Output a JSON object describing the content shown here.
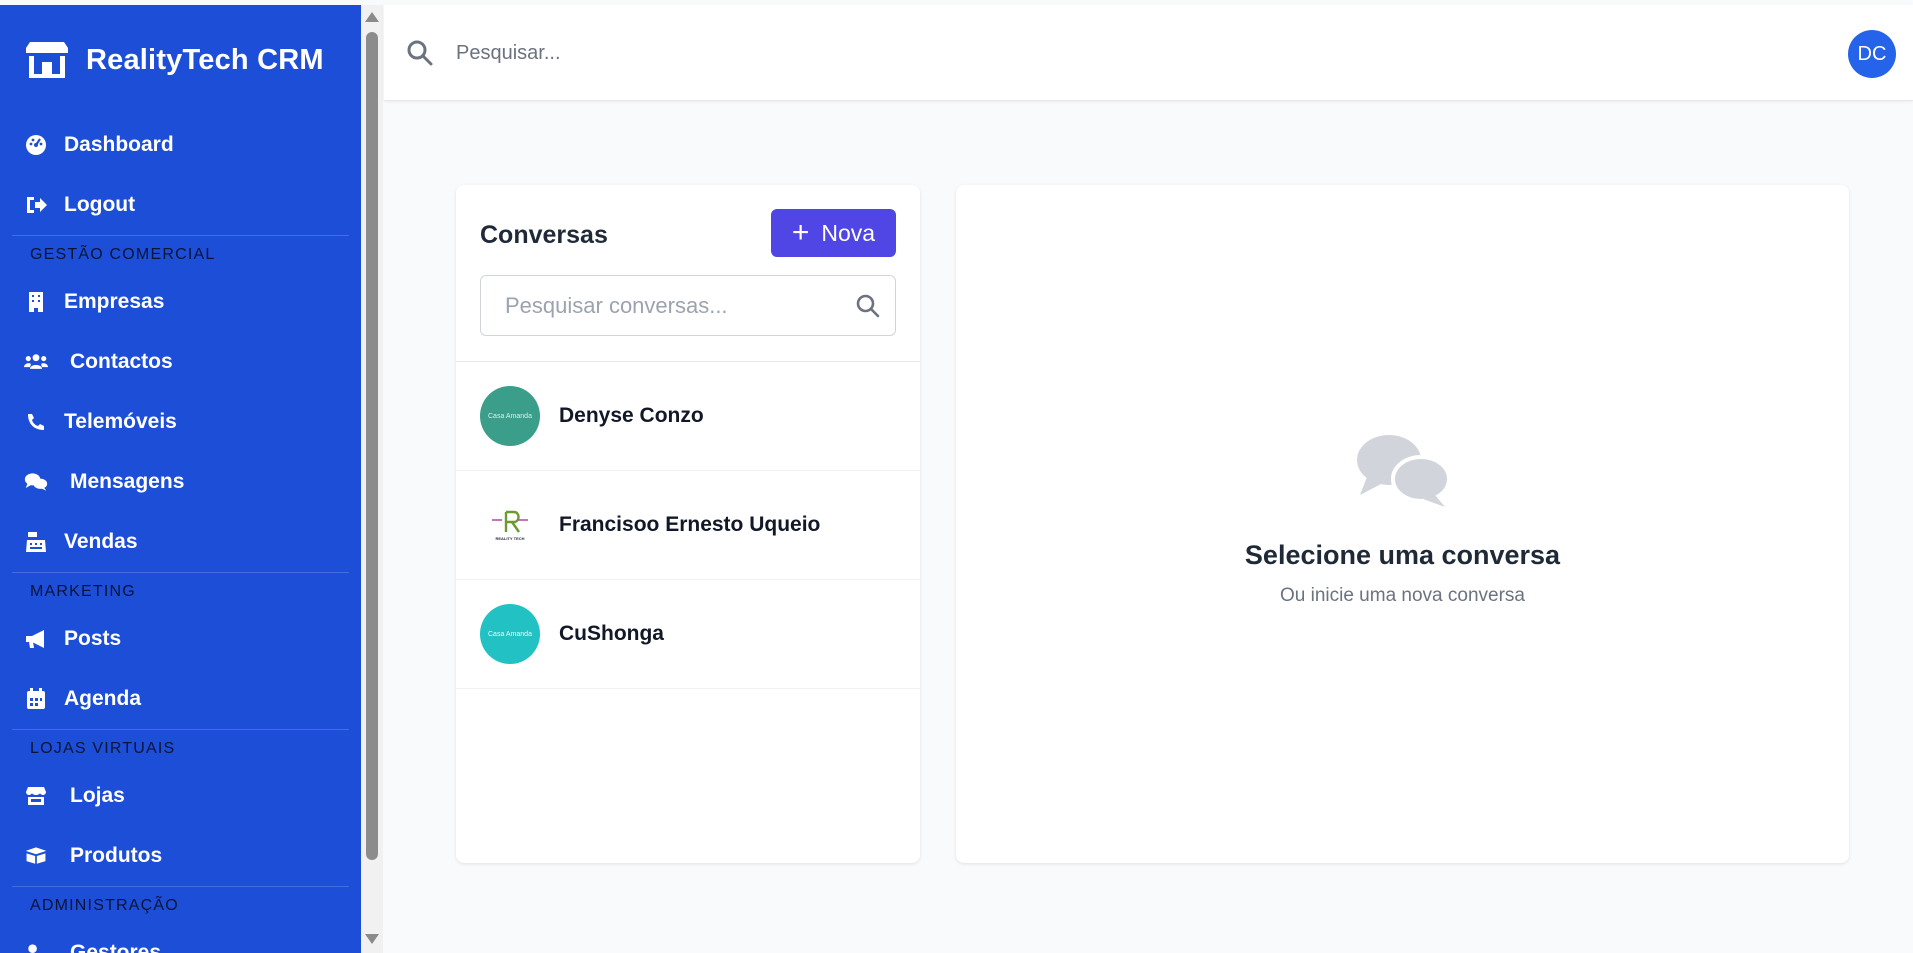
{
  "app": {
    "name": "RealityTech CRM"
  },
  "sidebar": {
    "items": [
      {
        "label": "Dashboard",
        "icon": "gauge-icon"
      },
      {
        "label": "Logout",
        "icon": "logout-icon"
      }
    ],
    "sections": [
      {
        "title": "GESTÃO COMERCIAL",
        "items": [
          {
            "label": "Empresas",
            "icon": "building-icon"
          },
          {
            "label": "Contactos",
            "icon": "users-icon"
          },
          {
            "label": "Telemóveis",
            "icon": "phone-icon"
          },
          {
            "label": "Mensagens",
            "icon": "comments-icon"
          },
          {
            "label": "Vendas",
            "icon": "cash-register-icon"
          }
        ]
      },
      {
        "title": "MARKETING",
        "items": [
          {
            "label": "Posts",
            "icon": "bullhorn-icon"
          },
          {
            "label": "Agenda",
            "icon": "calendar-icon"
          }
        ]
      },
      {
        "title": "LOJAS VIRTUAIS",
        "items": [
          {
            "label": "Lojas",
            "icon": "store-icon"
          },
          {
            "label": "Produtos",
            "icon": "boxes-icon"
          }
        ]
      },
      {
        "title": "ADMINISTRAÇÃO",
        "items": [
          {
            "label": "Gestores",
            "icon": "user-gear-icon"
          }
        ]
      }
    ]
  },
  "topbar": {
    "search_placeholder": "Pesquisar...",
    "avatar_initials": "DC"
  },
  "conversations": {
    "title": "Conversas",
    "new_button": "Nova",
    "search_placeholder": "Pesquisar conversas...",
    "items": [
      {
        "name": "Denyse Conzo",
        "avatar_color": "#3a9e8a",
        "avatar_text": "Casa Amanda"
      },
      {
        "name": "Francisoo Ernesto Uqueio",
        "avatar_color": "#ffffff",
        "avatar_text": "REALITY TECH"
      },
      {
        "name": "CuShonga",
        "avatar_color": "#22c1c3",
        "avatar_text": "Casa Amanda"
      }
    ]
  },
  "empty_state": {
    "title": "Selecione uma conversa",
    "subtitle": "Ou inicie uma nova conversa"
  },
  "colors": {
    "sidebar": "#1d4ed8",
    "accent": "#4f46e5",
    "avatar": "#2563eb"
  }
}
